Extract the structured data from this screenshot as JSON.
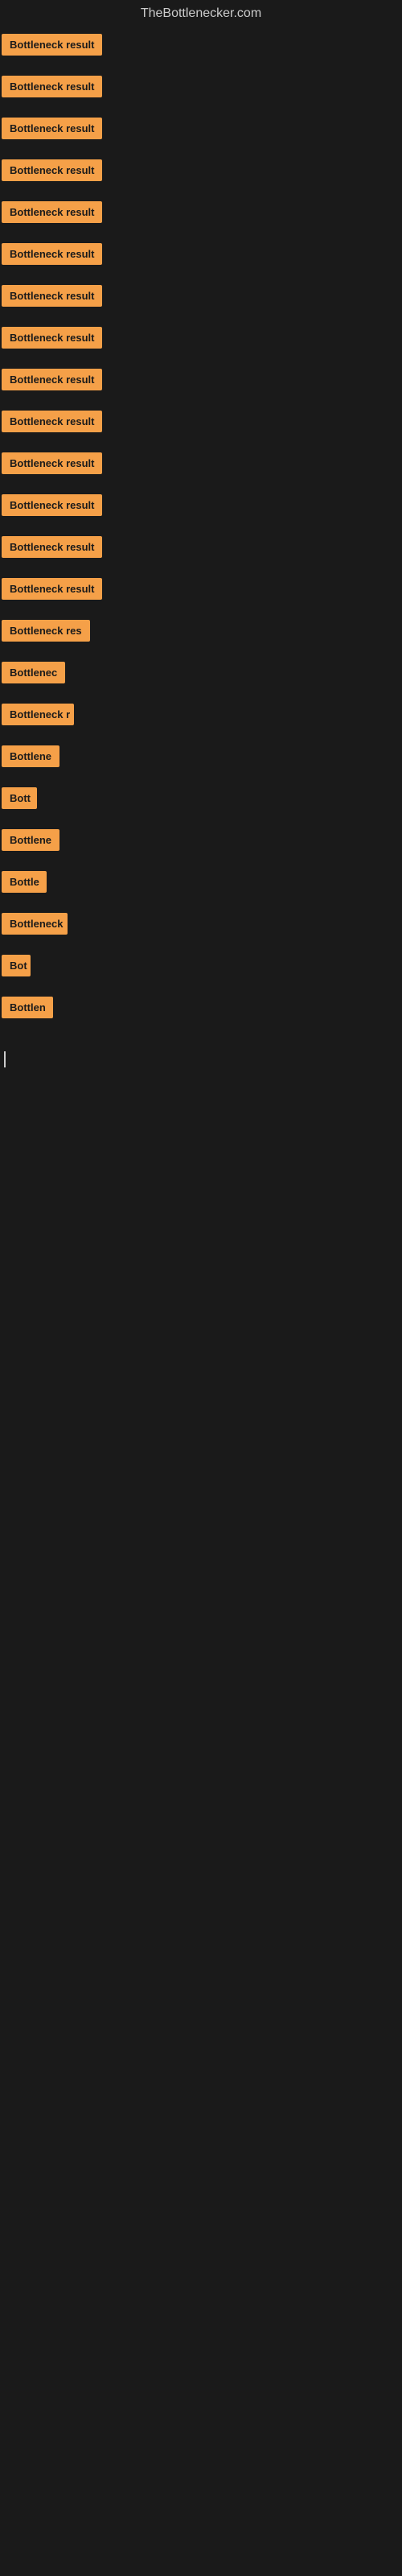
{
  "site": {
    "title": "TheBottlenecker.com"
  },
  "items": [
    {
      "label": "Bottleneck result",
      "width": 135
    },
    {
      "label": "Bottleneck result",
      "width": 135
    },
    {
      "label": "Bottleneck result",
      "width": 135
    },
    {
      "label": "Bottleneck result",
      "width": 135
    },
    {
      "label": "Bottleneck result",
      "width": 135
    },
    {
      "label": "Bottleneck result",
      "width": 135
    },
    {
      "label": "Bottleneck result",
      "width": 135
    },
    {
      "label": "Bottleneck result",
      "width": 135
    },
    {
      "label": "Bottleneck result",
      "width": 135
    },
    {
      "label": "Bottleneck result",
      "width": 135
    },
    {
      "label": "Bottleneck result",
      "width": 135
    },
    {
      "label": "Bottleneck result",
      "width": 135
    },
    {
      "label": "Bottleneck result",
      "width": 135
    },
    {
      "label": "Bottleneck result",
      "width": 135
    },
    {
      "label": "Bottleneck res",
      "width": 115
    },
    {
      "label": "Bottlenec",
      "width": 80
    },
    {
      "label": "Bottleneck r",
      "width": 90
    },
    {
      "label": "Bottlene",
      "width": 72
    },
    {
      "label": "Bott",
      "width": 44
    },
    {
      "label": "Bottlene",
      "width": 72
    },
    {
      "label": "Bottle",
      "width": 56
    },
    {
      "label": "Bottleneck",
      "width": 82
    },
    {
      "label": "Bot",
      "width": 36
    },
    {
      "label": "Bottlen",
      "width": 64
    }
  ]
}
